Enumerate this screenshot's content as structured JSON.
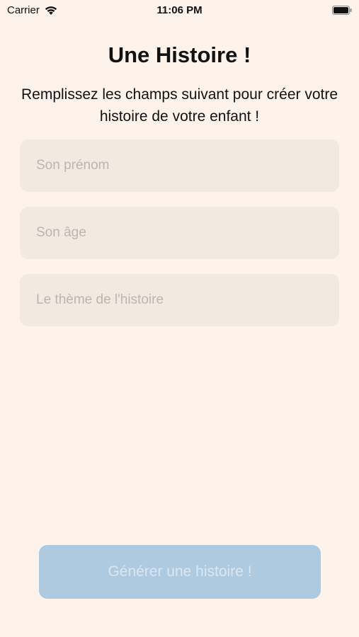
{
  "status_bar": {
    "carrier": "Carrier",
    "time": "11:06 PM",
    "wifi_icon": "wifi-icon",
    "battery_icon": "battery-icon"
  },
  "page": {
    "title": "Une Histoire !",
    "subtitle": "Remplissez les champs suivant pour créer votre histoire de votre enfant !"
  },
  "form": {
    "first_name_placeholder": "Son prénom",
    "age_placeholder": "Son âge",
    "theme_placeholder": "Le thème de l'histoire"
  },
  "actions": {
    "generate_label": "Générer une histoire !"
  },
  "colors": {
    "background": "#fdf3ea",
    "field_background": "#f2e9e0",
    "button_background": "#aecae0"
  }
}
